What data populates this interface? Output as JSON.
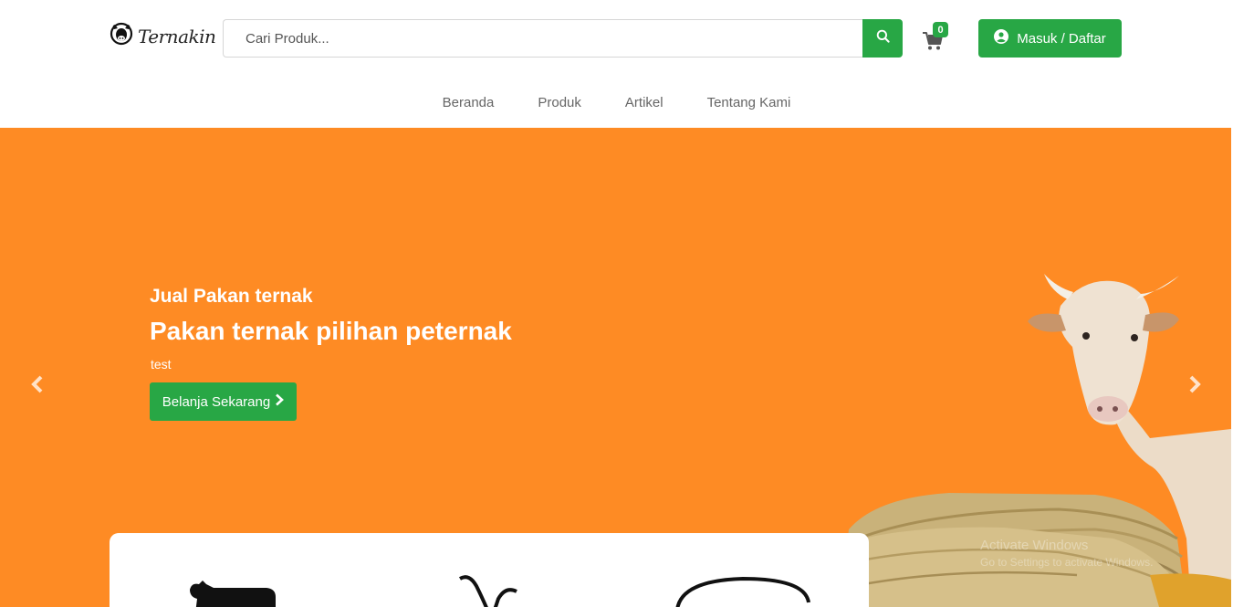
{
  "brand": {
    "name": "Ternakin"
  },
  "search": {
    "placeholder": "Cari Produk..."
  },
  "cart": {
    "count": "0"
  },
  "header": {
    "login_label": "Masuk / Daftar"
  },
  "nav": [
    {
      "label": "Beranda"
    },
    {
      "label": "Produk"
    },
    {
      "label": "Artikel"
    },
    {
      "label": "Tentang Kami"
    }
  ],
  "hero": {
    "subtitle": "Jual Pakan ternak",
    "title": "Pakan ternak pilihan peternak",
    "description": "test",
    "cta_label": "Belanja Sekarang"
  },
  "watermark": {
    "line1": "Activate Windows",
    "line2": "Go to Settings to activate Windows."
  },
  "colors": {
    "accent": "#28a745",
    "hero_bg": "#fe8b24",
    "header_bg": "#ffffff"
  },
  "icons": [
    "cow-logo-icon",
    "search-icon",
    "cart-icon",
    "user-circle-icon",
    "chevron-right-icon",
    "carousel-prev-icon",
    "carousel-next-icon"
  ]
}
